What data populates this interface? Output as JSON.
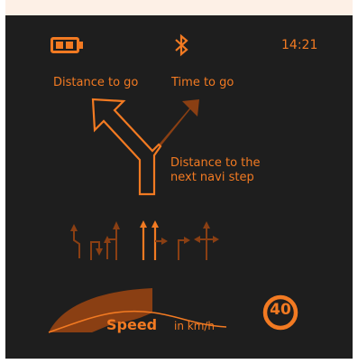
{
  "status_bar": {
    "time": "14:21",
    "battery_icon": "battery-icon",
    "bluetooth_icon": "bluetooth-icon"
  },
  "labels": {
    "distance_to_go": "Distance to go",
    "time_to_go": "Time to go",
    "next_step_line1": "Distance to the",
    "next_step_line2": "next navi step"
  },
  "navigation": {
    "turn_arrow_icon": "fork-left-arrow-icon"
  },
  "lanes": {
    "icons": [
      "lane-uturn-left-icon",
      "lane-turn-right-down-icon",
      "lane-left-straight-icon",
      "lane-straight-icon",
      "lane-straight-right-icon",
      "lane-turn-right-icon",
      "lane-all-directions-icon"
    ],
    "active_index": 3
  },
  "speed": {
    "label": "Speed",
    "unit": "in km/h",
    "limit": "40"
  },
  "colors": {
    "accent": "#f27a22",
    "dim": "#8a3f13",
    "background": "#1e1e1e",
    "topbar": "#fdf0e6"
  }
}
